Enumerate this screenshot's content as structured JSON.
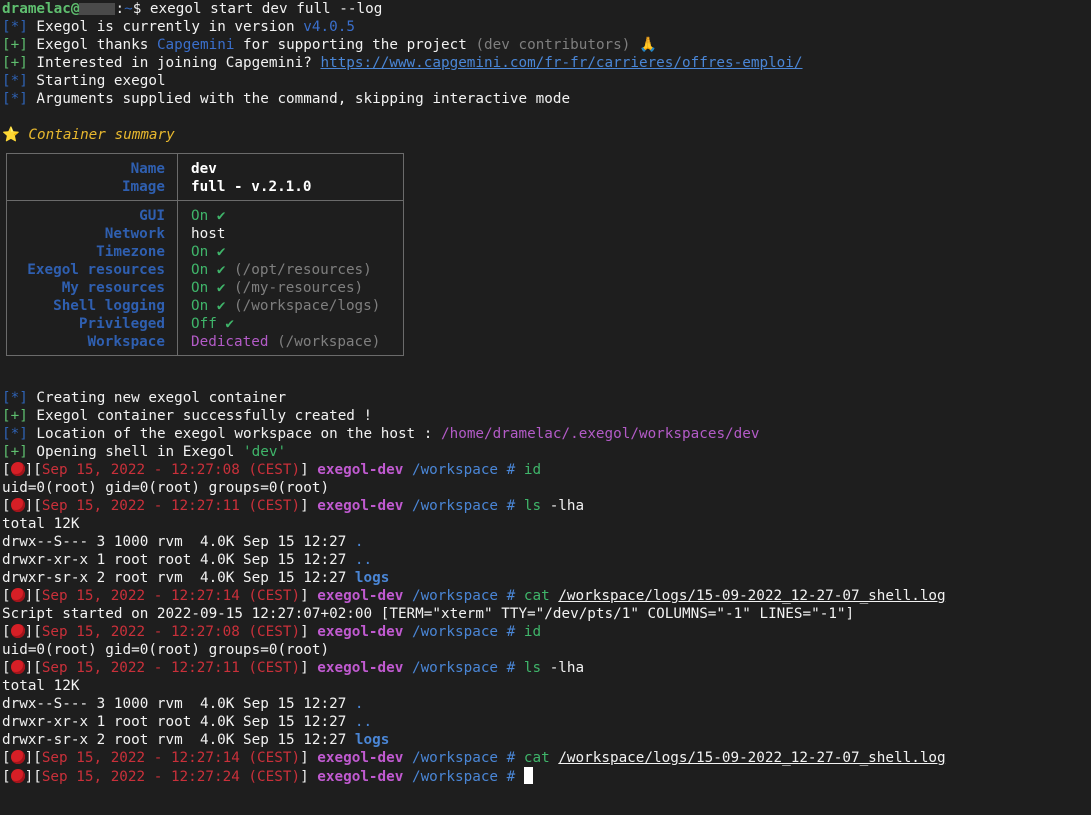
{
  "prompt": {
    "user": "dramelac@",
    "sep": ":",
    "path": "~",
    "symbol": "$",
    "command": " exegol start dev full --log"
  },
  "header": [
    {
      "tag": "[*]",
      "tag_color": "blue",
      "parts": [
        {
          "t": " Exegol is currently in version ",
          "c": "white"
        },
        {
          "t": "v4.0.5",
          "c": "bblue"
        }
      ]
    },
    {
      "tag": "[+]",
      "tag_color": "green",
      "parts": [
        {
          "t": " Exegol thanks ",
          "c": "white"
        },
        {
          "t": "Capgemini",
          "c": "bblue"
        },
        {
          "t": " for supporting the project ",
          "c": "white"
        },
        {
          "t": "(dev contributors)",
          "c": "gray"
        },
        {
          "t": " 🙏",
          "c": "yellow-n"
        }
      ]
    },
    {
      "tag": "[+]",
      "tag_color": "green",
      "parts": [
        {
          "t": " Interested in joining Capgemini? ",
          "c": "white"
        },
        {
          "t": "https://www.capgemini.com/fr-fr/carrieres/offres-emploi/",
          "c": "link"
        }
      ]
    },
    {
      "tag": "[*]",
      "tag_color": "blue",
      "parts": [
        {
          "t": " Starting exegol",
          "c": "white"
        }
      ]
    },
    {
      "tag": "[*]",
      "tag_color": "blue",
      "parts": [
        {
          "t": " Arguments supplied with the command, skipping interactive mode",
          "c": "white"
        }
      ]
    }
  ],
  "summary_title": {
    "icon": "⭐",
    "text": " Container summary"
  },
  "summary": {
    "section1": [
      {
        "key": "Name",
        "value": "dev",
        "bold": true
      },
      {
        "key": "Image",
        "value": "full - v.2.1.0",
        "bold": true
      }
    ],
    "section2": [
      {
        "key": "GUI",
        "parts": [
          {
            "t": "On ✔",
            "c": "ok"
          }
        ]
      },
      {
        "key": "Network",
        "parts": [
          {
            "t": "host",
            "c": "white"
          }
        ]
      },
      {
        "key": "Timezone",
        "parts": [
          {
            "t": "On ✔",
            "c": "ok"
          }
        ]
      },
      {
        "key": "Exegol resources",
        "parts": [
          {
            "t": "On ✔",
            "c": "ok"
          },
          {
            "t": " (/opt/resources)",
            "c": "gray"
          }
        ]
      },
      {
        "key": "My resources",
        "parts": [
          {
            "t": "On ✔",
            "c": "ok"
          },
          {
            "t": " (/my-resources)",
            "c": "gray"
          }
        ]
      },
      {
        "key": "Shell logging",
        "parts": [
          {
            "t": "On ✔",
            "c": "ok"
          },
          {
            "t": " (/workspace/logs)",
            "c": "gray"
          }
        ]
      },
      {
        "key": "Privileged",
        "parts": [
          {
            "t": "Off ✔",
            "c": "ok"
          }
        ]
      },
      {
        "key": "Workspace",
        "parts": [
          {
            "t": "Dedicated",
            "c": "magenta-n"
          },
          {
            "t": " (/workspace)",
            "c": "gray"
          }
        ]
      }
    ]
  },
  "post": [
    {
      "tag": "[*]",
      "tag_color": "blue",
      "parts": [
        {
          "t": " Creating new exegol container",
          "c": "white"
        }
      ]
    },
    {
      "tag": "[+]",
      "tag_color": "green",
      "parts": [
        {
          "t": " Exegol container successfully created !",
          "c": "white"
        }
      ]
    },
    {
      "tag": "[*]",
      "tag_color": "blue",
      "parts": [
        {
          "t": " Location of the exegol workspace on the host : ",
          "c": "white"
        },
        {
          "t": "/home/dramelac/.exegol/workspaces/dev",
          "c": "magenta-n"
        }
      ]
    },
    {
      "tag": "[+]",
      "tag_color": "green",
      "parts": [
        {
          "t": " Opening shell in Exegol ",
          "c": "white"
        },
        {
          "t": "'dev'",
          "c": "ok"
        }
      ]
    }
  ],
  "shell_prompt": {
    "host": "exegol-dev",
    "cwd": "/workspace",
    "symbol": "#"
  },
  "session": [
    {
      "type": "prompt",
      "time": "Sep 15, 2022 - 12:27:08 (CEST)",
      "cmd": "id",
      "arg": ""
    },
    {
      "type": "out",
      "text": "uid=0(root) gid=0(root) groups=0(root)"
    },
    {
      "type": "prompt",
      "time": "Sep 15, 2022 - 12:27:11 (CEST)",
      "cmd": "ls",
      "arg": " -lha"
    },
    {
      "type": "out",
      "text": "total 12K"
    },
    {
      "type": "ls",
      "text": "drwx--S--- 3 1000 rvm  4.0K Sep 15 12:27 ",
      "name": "."
    },
    {
      "type": "ls",
      "text": "drwxr-xr-x 1 root root 4.0K Sep 15 12:27 ",
      "name": ".."
    },
    {
      "type": "ls",
      "text": "drwxr-sr-x 2 root rvm  4.0K Sep 15 12:27 ",
      "name": "logs",
      "bold": true
    },
    {
      "type": "prompt",
      "time": "Sep 15, 2022 - 12:27:14 (CEST)",
      "cmd": "cat",
      "arg": "/workspace/logs/15-09-2022_12-27-07_shell.log",
      "underline": true
    },
    {
      "type": "out",
      "text": "Script started on 2022-09-15 12:27:07+02:00 [TERM=\"xterm\" TTY=\"/dev/pts/1\" COLUMNS=\"-1\" LINES=\"-1\"]"
    },
    {
      "type": "prompt",
      "time": "Sep 15, 2022 - 12:27:08 (CEST)",
      "cmd": "id",
      "arg": ""
    },
    {
      "type": "out",
      "text": "uid=0(root) gid=0(root) groups=0(root)"
    },
    {
      "type": "prompt",
      "time": "Sep 15, 2022 - 12:27:11 (CEST)",
      "cmd": "ls",
      "arg": " -lha"
    },
    {
      "type": "out",
      "text": "total 12K"
    },
    {
      "type": "ls",
      "text": "drwx--S--- 3 1000 rvm  4.0K Sep 15 12:27 ",
      "name": "."
    },
    {
      "type": "ls",
      "text": "drwxr-xr-x 1 root root 4.0K Sep 15 12:27 ",
      "name": ".."
    },
    {
      "type": "ls",
      "text": "drwxr-sr-x 2 root rvm  4.0K Sep 15 12:27 ",
      "name": "logs",
      "bold": true
    },
    {
      "type": "prompt",
      "time": "Sep 15, 2022 - 12:27:14 (CEST)",
      "cmd": "cat",
      "arg": "/workspace/logs/15-09-2022_12-27-07_shell.log",
      "underline": true
    },
    {
      "type": "prompt",
      "time": "Sep 15, 2022 - 12:27:24 (CEST)",
      "cmd": "",
      "arg": "",
      "cursor": true
    }
  ]
}
